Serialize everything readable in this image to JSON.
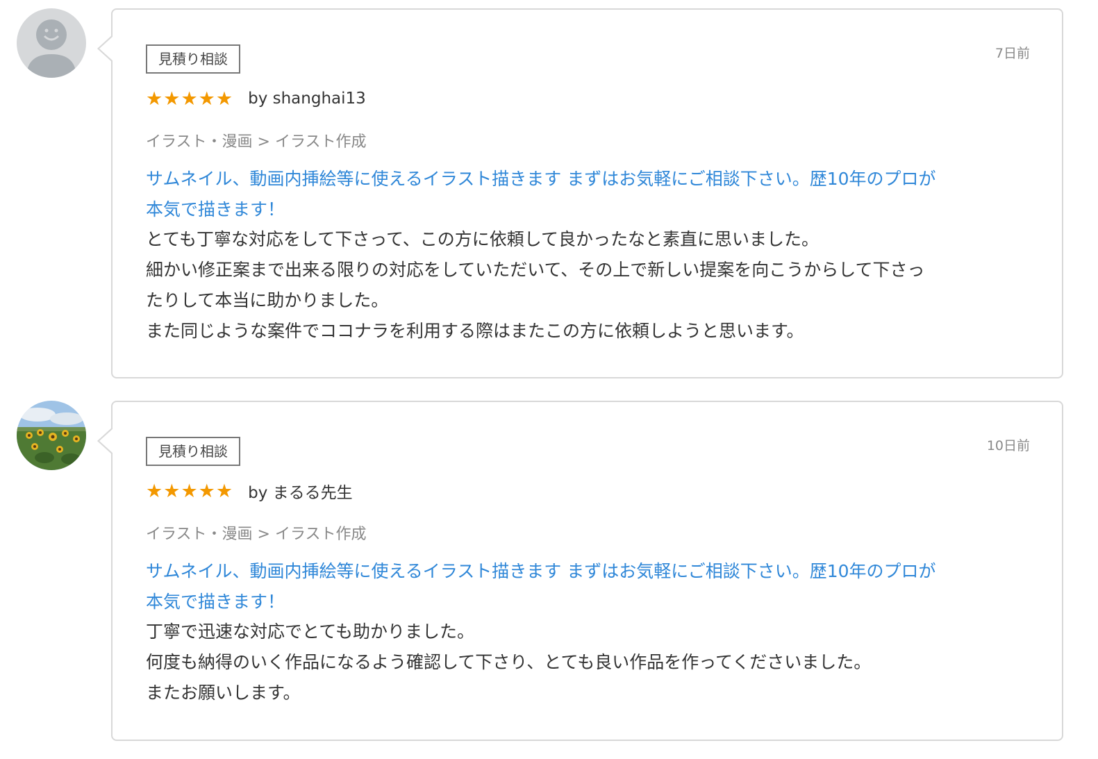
{
  "reviews": [
    {
      "tag": "見積り相談",
      "date": "7日前",
      "by": "by shanghai13",
      "stars": 5,
      "category": "イラスト・漫画 > イラスト作成",
      "service_line1": "サムネイル、動画内挿絵等に使えるイラスト描きます まずはお気軽にご相談下さい。歴10年のプロが",
      "service_line2": "本気で描きます！",
      "body": [
        "とても丁寧な対応をして下さって、この方に依頼して良かったなと素直に思いました。",
        "細かい修正案まで出来る限りの対応をしていただいて、その上で新しい提案を向こうからして下さっ",
        "たりして本当に助かりました。",
        "また同じような案件でココナラを利用する際はまたこの方に依頼しようと思います。"
      ]
    },
    {
      "tag": "見積り相談",
      "date": "10日前",
      "by": "by まるる先生",
      "stars": 5,
      "category": "イラスト・漫画 > イラスト作成",
      "service_line1": "サムネイル、動画内挿絵等に使えるイラスト描きます まずはお気軽にご相談下さい。歴10年のプロが",
      "service_line2": "本気で描きます！",
      "body": [
        "丁寧で迅速な対応でとても助かりました。",
        "何度も納得のいく作品になるよう確認して下さり、とても良い作品を作ってくださいました。",
        "またお願いします。"
      ]
    }
  ],
  "colors": {
    "star": "#f39800",
    "link": "#2f87d8",
    "border": "#d8d8d8"
  }
}
